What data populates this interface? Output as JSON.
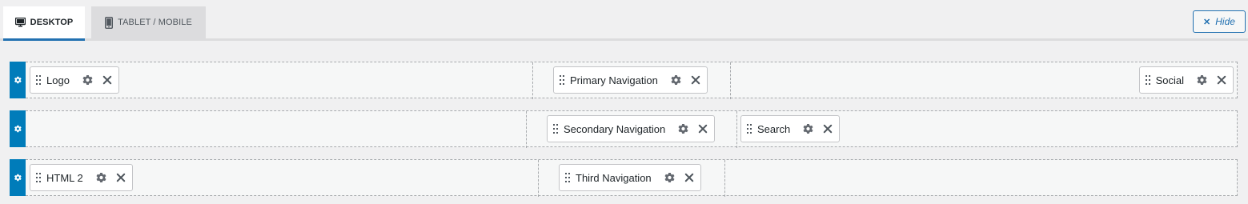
{
  "tabs": {
    "desktop": {
      "label": "DESKTOP",
      "icon": "desktop-icon",
      "active": true
    },
    "tablet": {
      "label": "TABLET / MOBILE",
      "icon": "tablet-icon",
      "active": false
    }
  },
  "hide_button": {
    "label": "Hide",
    "icon": "close-icon"
  },
  "rows": [
    {
      "name": "top-row",
      "items": [
        {
          "label": "Logo"
        },
        {
          "label": "Primary Navigation"
        },
        {
          "label": "Social"
        }
      ]
    },
    {
      "name": "main-row",
      "items": [
        {
          "label": "Secondary Navigation"
        },
        {
          "label": "Search"
        }
      ]
    },
    {
      "name": "bottom-row",
      "items": [
        {
          "label": "HTML 2"
        },
        {
          "label": "Third Navigation"
        }
      ]
    }
  ],
  "colors": {
    "accent": "#2271b1",
    "row_gear_bg": "#007cba",
    "page_bg": "#f0f0f1"
  }
}
